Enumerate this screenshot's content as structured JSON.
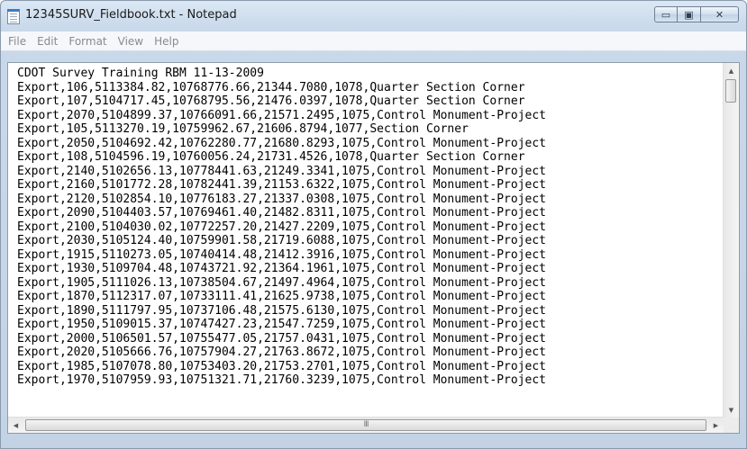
{
  "window": {
    "title": "12345SURV_Fieldbook.txt - Notepad",
    "minimize_glyph": "▭",
    "maximize_glyph": "▣",
    "close_glyph": "✕"
  },
  "menu": {
    "file": "File",
    "edit": "Edit",
    "format": "Format",
    "view": "View",
    "help": "Help"
  },
  "document": {
    "lines": [
      "CDOT Survey Training RBM 11-13-2009",
      "Export,106,5113384.82,10768776.66,21344.7080,1078,Quarter Section Corner",
      "Export,107,5104717.45,10768795.56,21476.0397,1078,Quarter Section Corner",
      "Export,2070,5104899.37,10766091.66,21571.2495,1075,Control Monument-Project",
      "Export,105,5113270.19,10759962.67,21606.8794,1077,Section Corner",
      "Export,2050,5104692.42,10762280.77,21680.8293,1075,Control Monument-Project",
      "Export,108,5104596.19,10760056.24,21731.4526,1078,Quarter Section Corner",
      "Export,2140,5102656.13,10778441.63,21249.3341,1075,Control Monument-Project",
      "Export,2160,5101772.28,10782441.39,21153.6322,1075,Control Monument-Project",
      "Export,2120,5102854.10,10776183.27,21337.0308,1075,Control Monument-Project",
      "Export,2090,5104403.57,10769461.40,21482.8311,1075,Control Monument-Project",
      "Export,2100,5104030.02,10772257.20,21427.2209,1075,Control Monument-Project",
      "Export,2030,5105124.40,10759901.58,21719.6088,1075,Control Monument-Project",
      "Export,1915,5110273.05,10740414.48,21412.3916,1075,Control Monument-Project",
      "Export,1930,5109704.48,10743721.92,21364.1961,1075,Control Monument-Project",
      "Export,1905,5111026.13,10738504.67,21497.4964,1075,Control Monument-Project",
      "Export,1870,5112317.07,10733111.41,21625.9738,1075,Control Monument-Project",
      "Export,1890,5111797.95,10737106.48,21575.6130,1075,Control Monument-Project",
      "Export,1950,5109015.37,10747427.23,21547.7259,1075,Control Monument-Project",
      "Export,2000,5106501.57,10755477.05,21757.0431,1075,Control Monument-Project",
      "Export,2020,5105666.76,10757904.27,21763.8672,1075,Control Monument-Project",
      "Export,1985,5107078.80,10753403.20,21753.2701,1075,Control Monument-Project",
      "Export,1970,5107959.93,10751321.71,21760.3239,1075,Control Monument-Project"
    ]
  },
  "scrollbars": {
    "up_glyph": "▲",
    "down_glyph": "▼",
    "left_glyph": "◀",
    "right_glyph": "▶",
    "grip_glyph": "III"
  }
}
